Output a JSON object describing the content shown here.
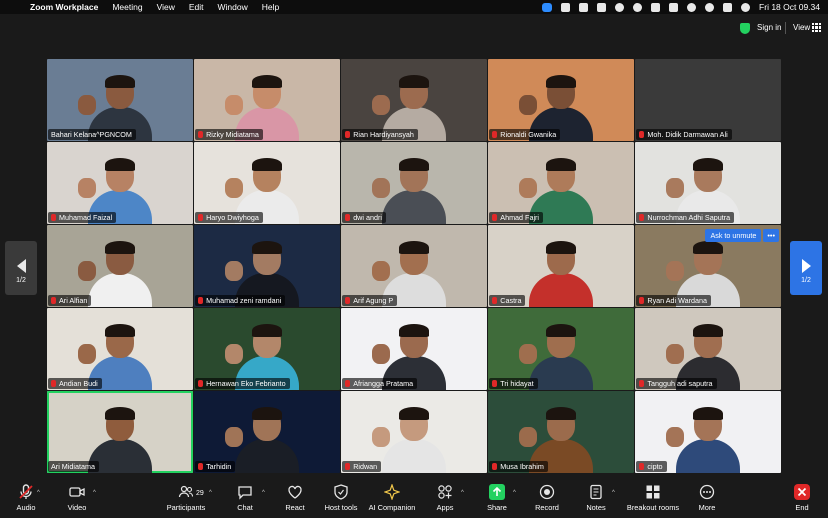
{
  "menubar": {
    "app": "Zoom Workplace",
    "items": [
      "Meeting",
      "View",
      "Edit",
      "Window",
      "Help"
    ],
    "datetime": "Fri 18 Oct  09.34"
  },
  "topbar": {
    "signin": "Sign in",
    "view": "View"
  },
  "gallery": {
    "page_left": "1/2",
    "page_right": "1/2",
    "ask_unmute": "Ask to unmute",
    "ask_more": "•••",
    "tiles": [
      {
        "name": "Bahari Kelana^PGNCOM",
        "muted": false,
        "bg": "#6a7d94",
        "skin": "#8a5a3f",
        "shirt": "#2d3540",
        "hand": true
      },
      {
        "name": "Rizky Midiatama",
        "muted": true,
        "bg": "#c9b7a7",
        "skin": "#c68c6a",
        "shirt": "#d996a6",
        "hand": true
      },
      {
        "name": "Rian Hardiyansyah",
        "muted": true,
        "bg": "#4a4440",
        "skin": "#9c6b4f",
        "shirt": "#b5aba2",
        "hand": true
      },
      {
        "name": "Rionaldi Gwanika",
        "muted": true,
        "bg": "#d08a58",
        "skin": "#7a4f36",
        "shirt": "#1d2330",
        "hand": true
      },
      {
        "name": "Moh. Didik Darmawan Ali",
        "muted": true,
        "bg": "#3a3a3a",
        "skin": "",
        "shirt": "",
        "hand": false
      },
      {
        "name": "Muhamad Faizal",
        "muted": true,
        "bg": "#d9d4cf",
        "skin": "#b78264",
        "shirt": "#4d86c7",
        "hand": true
      },
      {
        "name": "Haryo Dwiyhoga",
        "muted": true,
        "bg": "#e6e2dc",
        "skin": "#b5825f",
        "shirt": "#ebebeb",
        "hand": true
      },
      {
        "name": "dwi andri",
        "muted": true,
        "bg": "#b9b6ac",
        "skin": "#a27458",
        "shirt": "#4a4e55",
        "hand": true
      },
      {
        "name": "Ahmad Fajri",
        "muted": true,
        "bg": "#cbbfb2",
        "skin": "#ae7b5a",
        "shirt": "#2f7a55",
        "hand": true
      },
      {
        "name": "Nurrochman Adhi Saputra",
        "muted": true,
        "bg": "#e2e2df",
        "skin": "#a97a5d",
        "shirt": "#e9e9e9",
        "hand": true
      },
      {
        "name": "Ari Alfian",
        "muted": true,
        "bg": "#a8a496",
        "skin": "#8a5b41",
        "shirt": "#f0f0f0",
        "hand": true
      },
      {
        "name": "Muhamad zeni ramdani",
        "muted": true,
        "bg": "#1c2a44",
        "skin": "#a37b62",
        "shirt": "#151820",
        "hand": true
      },
      {
        "name": "Arif Agung P",
        "muted": true,
        "bg": "#c0b8ad",
        "skin": "#a26f4f",
        "shirt": "#ddd",
        "hand": true
      },
      {
        "name": "Castra",
        "muted": true,
        "bg": "#d8d2c8",
        "skin": "#9d6a4c",
        "shirt": "#c4302b",
        "hand": false
      },
      {
        "name": "Ryan Adi Wardana",
        "muted": true,
        "bg": "#8a7a60",
        "skin": "#a47457",
        "shirt": "#d9d9d9",
        "hand": true
      },
      {
        "name": "Andian Budi",
        "muted": true,
        "bg": "#e4e0d8",
        "skin": "#9a6849",
        "shirt": "#4e7fbf",
        "hand": true
      },
      {
        "name": "Hernawan Eko Febrianto",
        "muted": true,
        "bg": "#2a4a2e",
        "skin": "#b3876a",
        "shirt": "#36a8c8",
        "hand": true
      },
      {
        "name": "Afriangga Pratama",
        "muted": true,
        "bg": "#f2f2f4",
        "skin": "#9b6a4e",
        "shirt": "#2c2f36",
        "hand": true
      },
      {
        "name": "Tri hidayat",
        "muted": true,
        "bg": "#3f6b3a",
        "skin": "#9f6e4e",
        "shirt": "#2a3b50",
        "hand": true
      },
      {
        "name": "Tangguh adi saputra",
        "muted": true,
        "bg": "#cfc8be",
        "skin": "#a06e50",
        "shirt": "#2c2c30",
        "hand": true
      },
      {
        "name": "Ari Midiatama",
        "muted": false,
        "bg": "#d6d2c7",
        "skin": "#8f5c3d",
        "shirt": "#2a2f36",
        "hand": false
      },
      {
        "name": "Tarhidin",
        "muted": true,
        "bg": "#0e1a36",
        "skin": "#a07457",
        "shirt": "#1a1e26",
        "hand": true
      },
      {
        "name": "Ridwan",
        "muted": true,
        "bg": "#ebeae6",
        "skin": "#c59a7e",
        "shirt": "#e5e5e5",
        "hand": true
      },
      {
        "name": "Musa Ibrahim",
        "muted": true,
        "bg": "#2c4d3a",
        "skin": "#9b6b4c",
        "shirt": "#7a4a25",
        "hand": true
      },
      {
        "name": "cipto",
        "muted": true,
        "bg": "#f1f1f3",
        "skin": "#a47457",
        "shirt": "#2e4a7a",
        "hand": true
      }
    ]
  },
  "toolbar": {
    "audio": "Audio",
    "video": "Video",
    "participants": "Participants",
    "participants_count": "29",
    "chat": "Chat",
    "react": "React",
    "host_tools": "Host tools",
    "ai_companion": "AI Companion",
    "apps": "Apps",
    "share": "Share",
    "record": "Record",
    "notes": "Notes",
    "breakout": "Breakout rooms",
    "more": "More",
    "end": "End"
  },
  "colors": {
    "accent": "#2d74e5",
    "active_speaker": "#23d160",
    "mute": "#e02828",
    "share": "#23d160"
  }
}
